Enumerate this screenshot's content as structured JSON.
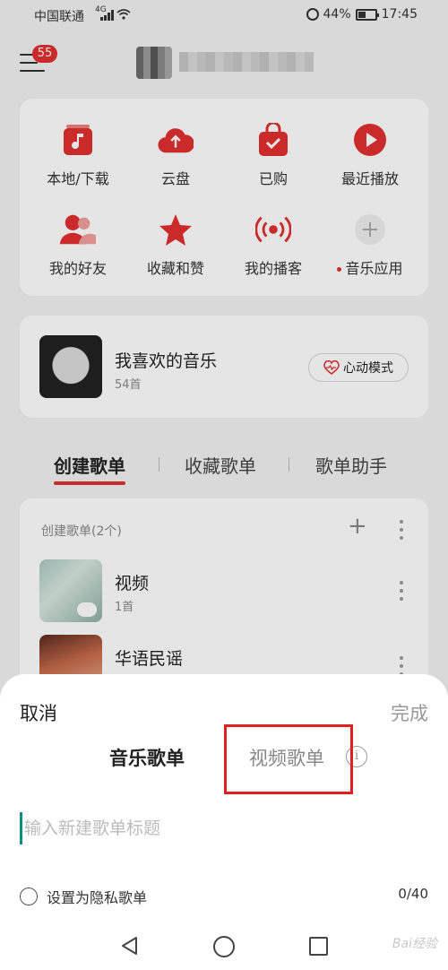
{
  "status_bar": {
    "carrier": "中国联通",
    "network": "4G",
    "battery_text": "44%",
    "battery_level": 0.44,
    "time": "17:45"
  },
  "header": {
    "badge_count": "55"
  },
  "quick_grid": [
    {
      "label": "本地/下载",
      "icon": "music-note-icon"
    },
    {
      "label": "云盘",
      "icon": "cloud-upload-icon"
    },
    {
      "label": "已购",
      "icon": "shopping-bag-check-icon"
    },
    {
      "label": "最近播放",
      "icon": "play-circle-icon"
    },
    {
      "label": "我的好友",
      "icon": "friends-icon"
    },
    {
      "label": "收藏和赞",
      "icon": "star-icon"
    },
    {
      "label": "我的播客",
      "icon": "broadcast-icon"
    },
    {
      "label": "音乐应用",
      "icon": "plus-icon"
    }
  ],
  "favorites": {
    "title": "我喜欢的音乐",
    "count": "54首",
    "heartbeat_button": "心动模式"
  },
  "tabs": [
    "创建歌单",
    "收藏歌单",
    "歌单助手"
  ],
  "playlist_section": {
    "header": "创建歌单(2个)",
    "items": [
      {
        "title": "视频",
        "sub": "1首"
      },
      {
        "title": "华语民谣",
        "sub": ""
      }
    ]
  },
  "sheet": {
    "cancel": "取消",
    "done": "完成",
    "segment_music": "音乐歌单",
    "segment_video": "视频歌单",
    "info": "i",
    "input_placeholder": "输入新建歌单标题",
    "privacy_label": "设置为隐私歌单",
    "counter": "0/40"
  },
  "watermark": "Bai经验",
  "colors": {
    "accent": "#e22f2f",
    "cursor": "#0a8f7f",
    "highlight": "#e02020"
  }
}
